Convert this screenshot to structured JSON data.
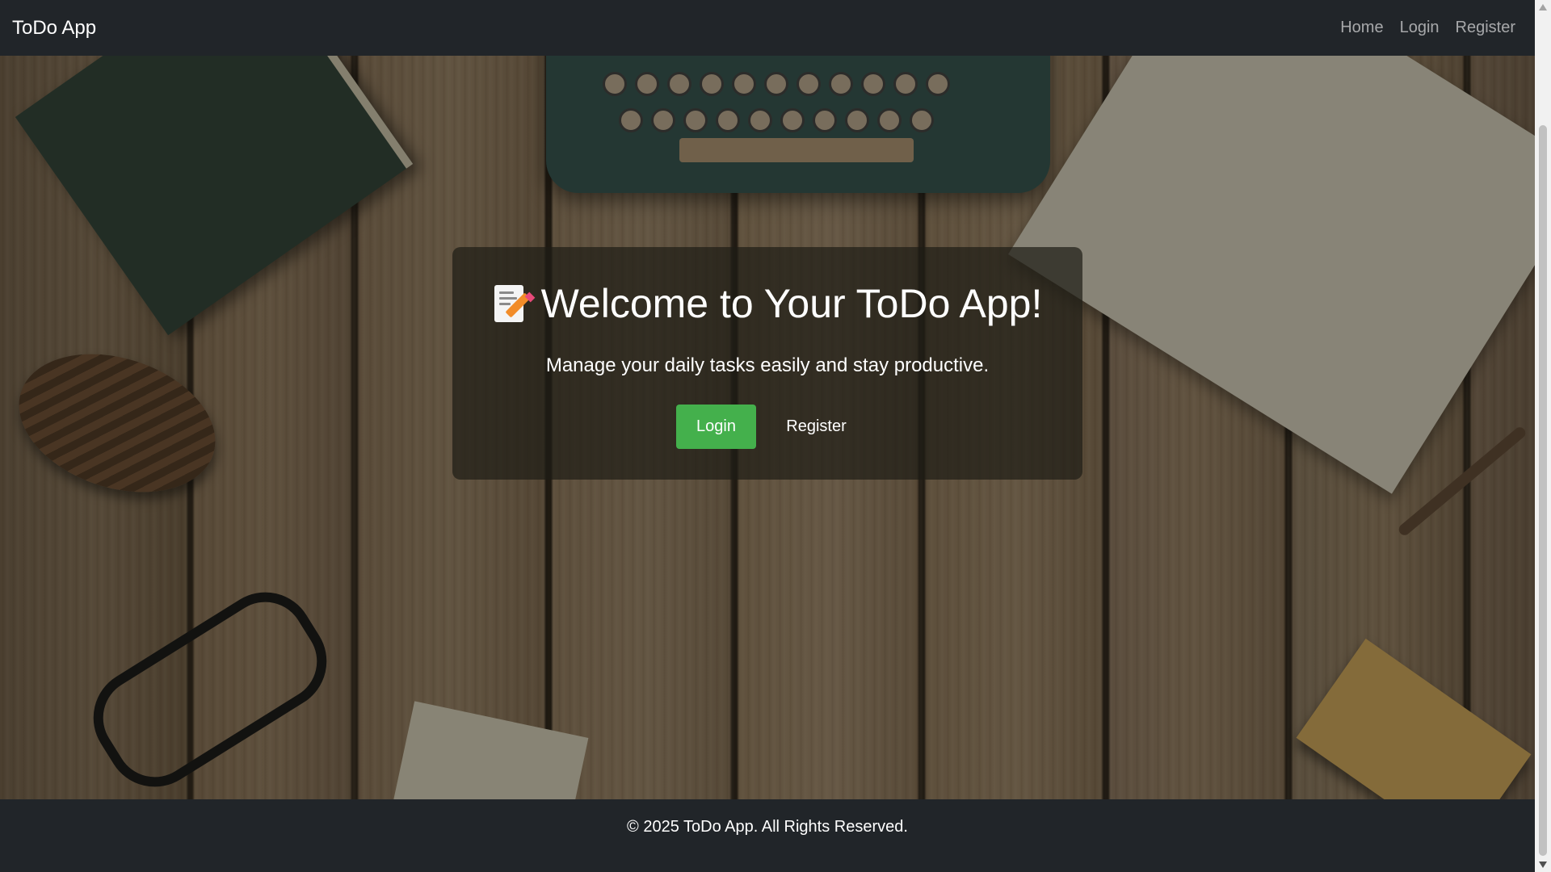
{
  "navbar": {
    "brand": "ToDo App",
    "links": [
      "Home",
      "Login",
      "Register"
    ]
  },
  "hero": {
    "title": "Welcome to Your ToDo App!",
    "title_icon": "memo-icon",
    "subtitle": "Manage your daily tasks easily and stay productive.",
    "login_label": "Login",
    "register_label": "Register"
  },
  "footer": {
    "text": "© 2025 ToDo App. All Rights Reserved."
  },
  "colors": {
    "navbar_bg": "#212529",
    "login_button": "#44b04c",
    "nav_link": "rgba(255,255,255,0.6)"
  }
}
